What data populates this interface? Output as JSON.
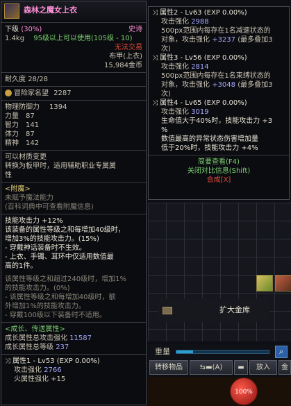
{
  "tooltip": {
    "item_name": "森林之魔女上衣",
    "level_label": "下级",
    "level_value": "(30%)",
    "rarity": "史诗",
    "weight": "1.4kg",
    "level_req": "95级以上可以使用(105级 - 10)",
    "trade": "无法交易",
    "type": "布甲(上衣)",
    "price": "15,984金币",
    "durability_label": "耐久度",
    "durability": "28/28",
    "fame_label": "冒险家名望",
    "fame_value": "2287",
    "stats": [
      {
        "name": "物理防御力",
        "value": "1394"
      },
      {
        "name": "力量",
        "value": "87"
      },
      {
        "name": "智力",
        "value": "141"
      },
      {
        "name": "体力",
        "value": "87"
      },
      {
        "name": "精神",
        "value": "142"
      }
    ],
    "material_1": "可以材质变更",
    "material_2": "转换为板甲时，适用辅助职业专属属",
    "material_3": "性",
    "enchant_header": "<附魔>",
    "enchant_none": "未赋予魔法能力",
    "enchant_hint": "(百科词典中可查看附魔信息)",
    "skill_lines": [
      "技能攻击力 +12%",
      "该装备的属性等级之和每增加40级时，",
      "增加3%的技能攻击力。(15%)",
      "- 穿戴神话装备时不生效。",
      "- 上衣、手镯、耳环中仅适用数值最",
      "高的1件。"
    ],
    "inactive_lines": [
      "该属性等级之和超过240级时，增加1%",
      "的技能攻击力。(0%)",
      "- 该属性等级之和每增加40级时，额",
      "外增加1%的技能攻击力。",
      "- 穿戴100级以下装备时不适用。"
    ],
    "growth_header": "<成长、传送属性>",
    "growth_1_label": "成长属性总攻击强化",
    "growth_1_value": "11587",
    "growth_2_label": "成长属性总等级",
    "growth_2_value": "237",
    "attr1_header": "属性1 - Lv53 (EXP 0.00%)",
    "attr1_line1_label": "攻击强化",
    "attr1_line1_value": "2766",
    "attr1_line2": "火属性强化 +15"
  },
  "attrs_panel": {
    "attr2_header": "属性2 - Lv63 (EXP 0.00%)",
    "attr2_atk_label": "攻击强化",
    "attr2_atk_value": "2988",
    "attr2_desc1": "500px范围内每存在1名减速状态的",
    "attr2_desc2_prefix": "对象，攻击强化",
    "attr2_desc2_value": "+3237",
    "attr2_desc2_suffix": "(最多叠加3",
    "attr2_desc3": "次)",
    "attr3_header": "属性3 - Lv56 (EXP 0.00%)",
    "attr3_atk_label": "攻击强化",
    "attr3_atk_value": "2814",
    "attr3_desc1": "500px范围内每存在1名束缚状态的",
    "attr3_desc2_prefix": "对象，攻击强化",
    "attr3_desc2_value": "+3048",
    "attr3_desc2_suffix": "(最多叠加3",
    "attr3_desc3": "次)",
    "attr4_header": "属性4 - Lv65 (EXP 0.00%)",
    "attr4_atk_label": "攻击强化",
    "attr4_atk_value": "3019",
    "attr4_desc1": "生命值大于40%时，技能攻击力 +3",
    "attr4_desc2": "%",
    "attr4_desc3": "数值最高的异常状态伤害增加量",
    "attr4_desc4": "低于20%时，技能攻击力 +4%",
    "link_brief": "简要查看(F4)",
    "link_compare": "关闭对比信息(Shift)",
    "link_combine": "合成[X]"
  },
  "inventory": {
    "expand_label": "扩大金库",
    "weight_label": "重量",
    "weight_fill": 0.18,
    "btn_transfer": "转移物品",
    "btn_sort": "(A)",
    "btn_put": "放入",
    "btn_right": "金",
    "hp_text": "100%"
  }
}
